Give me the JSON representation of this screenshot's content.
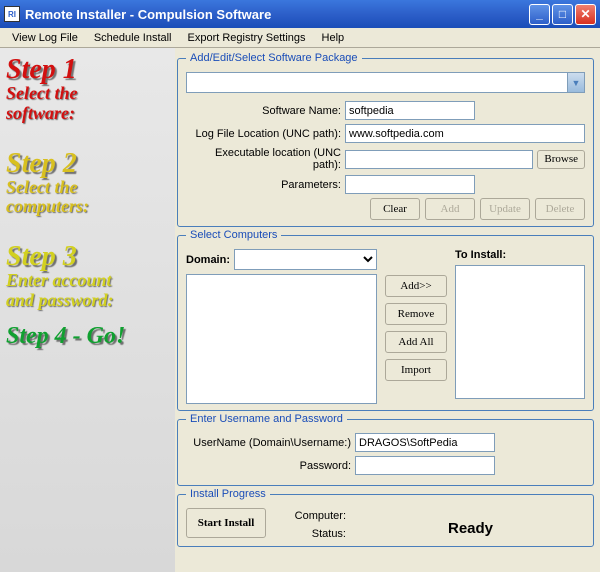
{
  "window": {
    "title": "Remote Installer - Compulsion Software",
    "icon": "RI"
  },
  "menu": {
    "viewLog": "View Log File",
    "schedule": "Schedule Install",
    "export": "Export Registry Settings",
    "help": "Help"
  },
  "sidebar": {
    "step1": {
      "title": "Step 1",
      "sub1": "Select the",
      "sub2": "software:"
    },
    "step2": {
      "title": "Step 2",
      "sub1": "Select the",
      "sub2": "computers:"
    },
    "step3": {
      "title": "Step 3",
      "sub1": "Enter account",
      "sub2": "and password:"
    },
    "step4": "Step 4 - Go!"
  },
  "pkg": {
    "legend": "Add/Edit/Select Software Package",
    "labels": {
      "name": "Software Name:",
      "logPath": "Log File Location (UNC path):",
      "exePath": "Executable location (UNC path):",
      "params": "Parameters:"
    },
    "values": {
      "name": "softpedia",
      "logPath": "www.softpedia.com",
      "exePath": "",
      "params": ""
    },
    "buttons": {
      "browse": "Browse",
      "clear": "Clear",
      "add": "Add",
      "update": "Update",
      "delete": "Delete"
    }
  },
  "comp": {
    "legend": "Select Computers",
    "domainLabel": "Domain:",
    "domainValue": "",
    "toInstall": "To Install:",
    "buttons": {
      "add": "Add>>",
      "remove": "Remove",
      "addAll": "Add All",
      "import": "Import"
    }
  },
  "cred": {
    "legend": "Enter Username and Password",
    "userLabel": "UserName (Domain\\Username:)",
    "userValue": "DRAGOS\\SoftPedia",
    "passLabel": "Password:",
    "passValue": ""
  },
  "install": {
    "legend": "Install Progress",
    "start": "Start Install",
    "computerLabel": "Computer:",
    "statusLabel": "Status:",
    "statusValue": "Ready"
  }
}
